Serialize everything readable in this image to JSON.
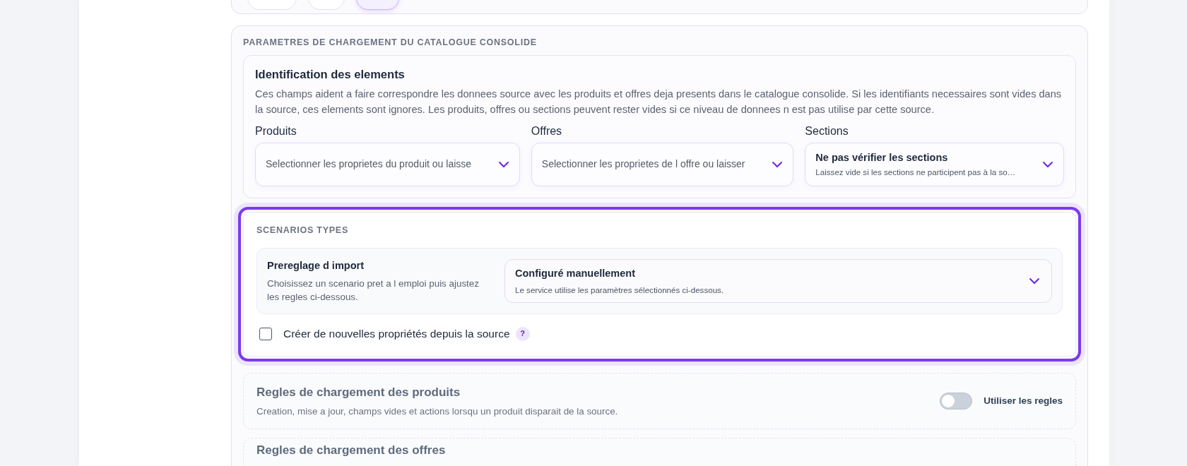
{
  "top_pills": [
    {
      "selected": false
    },
    {
      "selected": false
    },
    {
      "selected": true
    }
  ],
  "section": {
    "title": "PARAMETRES DE CHARGEMENT DU CATALOGUE CONSOLIDE",
    "identification": {
      "title": "Identification des elements",
      "description": "Ces champs aident a faire correspondre les donnees source avec les produits et offres deja presents dans le catalogue consolide. Si les identifiants necessaires sont vides dans la source, ces elements sont ignores. Les produits, offres ou sections peuvent rester vides si ce niveau de donnees n est pas utilise par cette source.",
      "fields": [
        {
          "kind": "placeholder",
          "label": "Produits",
          "placeholder": "Selectionner les proprietes du produit ou laisse"
        },
        {
          "kind": "placeholder",
          "label": "Offres",
          "placeholder": "Selectionner les proprietes de l offre ou laisser"
        },
        {
          "kind": "value",
          "label": "Sections",
          "value": "Ne pas vérifier les sections",
          "hint": "Laissez vide si les sections ne participent pas à la so…"
        }
      ]
    },
    "scenarios": {
      "title": "SCENARIOS TYPES",
      "preset_label": "Prereglage d import",
      "preset_help": "Choisissez un scenario pret a l emploi puis ajustez les regles ci-dessous.",
      "preset_value": "Configuré manuellement",
      "preset_hint": "Le service utilise les paramètres sélectionnés ci-dessous.",
      "checkbox": {
        "label": "Créer de nouvelles propriétés depuis la source",
        "checked": false,
        "help": "?"
      }
    },
    "rules": [
      {
        "title": "Regles de chargement des produits",
        "description": "Creation, mise a jour, champs vides et actions lorsqu un produit disparait de la source.",
        "toggle_label": "Utiliser les regles",
        "on": false
      },
      {
        "title": "Regles de chargement des offres"
      }
    ]
  }
}
